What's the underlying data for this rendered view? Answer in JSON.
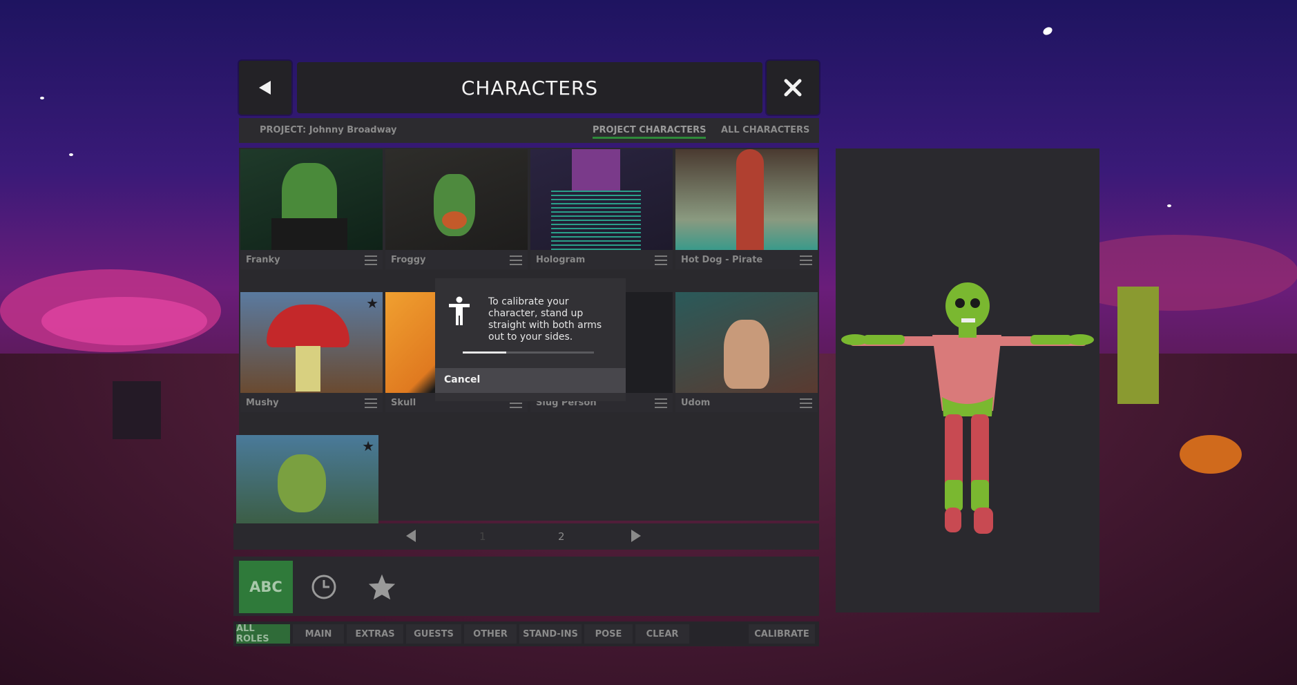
{
  "header": {
    "title": "CHARACTERS",
    "back_icon": "back-arrow-icon",
    "close_icon": "close-icon"
  },
  "project_bar": {
    "project_label": "PROJECT: Johnny Broadway",
    "tabs": [
      {
        "label": "PROJECT CHARACTERS",
        "active": true
      },
      {
        "label": "ALL CHARACTERS",
        "active": false
      }
    ]
  },
  "characters": [
    {
      "name": "Franky",
      "theme": "#3b5a3a"
    },
    {
      "name": "Froggy",
      "theme": "#3a3a36"
    },
    {
      "name": "Hologram",
      "theme": "#3b2e52"
    },
    {
      "name": "Hot Dog - Pirate",
      "theme": "#6a5a4a"
    },
    {
      "name": "Mushy",
      "theme": "#5a4a3a"
    },
    {
      "name": "Skull",
      "theme": "#7a5a2a"
    },
    {
      "name": "Slug Person",
      "theme": "#222226"
    },
    {
      "name": "Udom",
      "theme": "#5a4838"
    },
    {
      "name": "",
      "theme": "#3a5a4a"
    }
  ],
  "pagination": {
    "pages": [
      "1",
      "2"
    ],
    "current": "2"
  },
  "sort_options": [
    {
      "label": "ABC",
      "active": true
    },
    {
      "icon": "clock-icon"
    },
    {
      "icon": "star-icon"
    }
  ],
  "roles": [
    "ALL ROLES",
    "MAIN",
    "EXTRAS",
    "GUESTS",
    "OTHER",
    "STAND-INS",
    "POSE",
    "CLEAR",
    "CALIBRATE"
  ],
  "active_role": "ALL ROLES",
  "calibration_dialog": {
    "message": "To calibrate your character, stand up straight with both arms out to your sides.",
    "progress": 0.33,
    "cancel_label": "Cancel",
    "icon": "person-icon"
  },
  "colors": {
    "panel": "#232226",
    "accent_green": "#2f7a3a"
  }
}
